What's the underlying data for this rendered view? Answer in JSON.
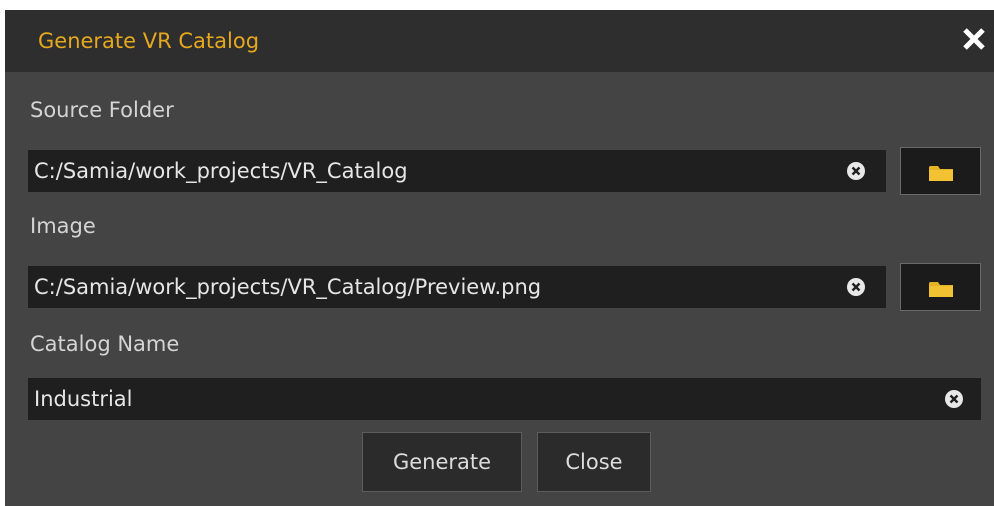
{
  "dialog": {
    "title": "Generate VR Catalog",
    "close_icon": "close-icon",
    "accent_color": "#e6a81d"
  },
  "source_folder": {
    "label": "Source Folder",
    "value": "C:/Samia/work_projects/VR_Catalog",
    "clear_icon": "clear-icon",
    "browse_icon": "folder-icon"
  },
  "image": {
    "label": "Image",
    "value": "C:/Samia/work_projects/VR_Catalog/Preview.png",
    "clear_icon": "clear-icon",
    "browse_icon": "folder-icon"
  },
  "catalog_name": {
    "label": "Catalog Name",
    "value": "Industrial",
    "clear_icon": "clear-icon"
  },
  "buttons": {
    "generate_label": "Generate",
    "close_label": "Close"
  }
}
